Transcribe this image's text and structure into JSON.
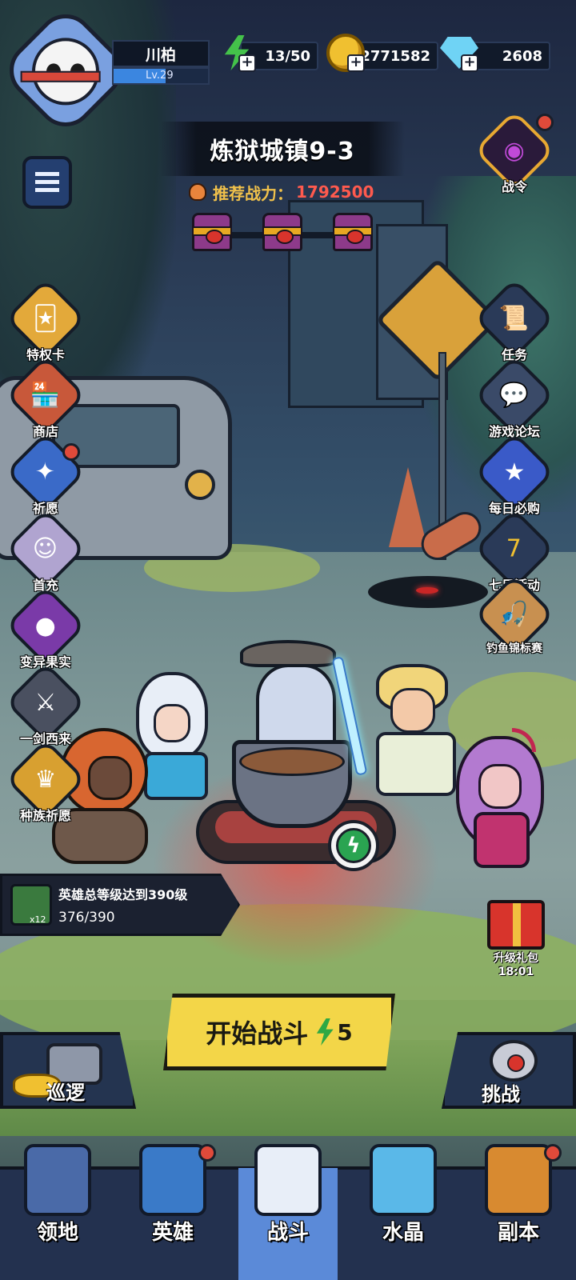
{
  "player": {
    "name": "川柏",
    "level": "Lv.29",
    "level_progress": 0.55
  },
  "resources": {
    "energy": "13/50",
    "gold": "2771582",
    "gems": "2608"
  },
  "stage": {
    "title": "炼狱城镇9-3",
    "power_label": "推荐战力：",
    "power_value": "1792500"
  },
  "left_menu": [
    {
      "label": "特权卡",
      "icon": "privilege-card-icon"
    },
    {
      "label": "商店",
      "icon": "shop-icon"
    },
    {
      "label": "祈愿",
      "icon": "wish-icon"
    },
    {
      "label": "首充",
      "icon": "first-recharge-icon"
    },
    {
      "label": "变异果实",
      "icon": "mutant-fruit-icon"
    },
    {
      "label": "一剑西来",
      "icon": "sword-event-icon"
    },
    {
      "label": "种族祈愿",
      "icon": "race-wish-icon"
    }
  ],
  "right_menu": [
    {
      "label": "战令",
      "icon": "battle-pass-eye-icon"
    },
    {
      "label": "任务",
      "icon": "quest-scroll-icon"
    },
    {
      "label": "游戏论坛",
      "icon": "forum-chat-icon"
    },
    {
      "label": "每日必购",
      "icon": "daily-deal-icon"
    },
    {
      "label": "七日活动",
      "icon": "seven-day-icon"
    },
    {
      "label": "钓鱼锦标赛",
      "icon": "fishing-contest-icon"
    }
  ],
  "quest": {
    "title": "英雄总等级达到390级",
    "progress": "376/390",
    "reward_count": "x12"
  },
  "gift": {
    "label": "升级礼包",
    "timer": "18:01"
  },
  "battle": {
    "start_label": "开始战斗",
    "cost": "5",
    "patrol_label": "巡逻",
    "challenge_label": "挑战"
  },
  "nav": [
    {
      "label": "领地",
      "icon": "territory-castle-icon"
    },
    {
      "label": "英雄",
      "icon": "hero-hat-icon"
    },
    {
      "label": "战斗",
      "icon": "battle-sword-icon",
      "active": true
    },
    {
      "label": "水晶",
      "icon": "crystal-icon"
    },
    {
      "label": "副本",
      "icon": "dungeon-portal-icon"
    }
  ],
  "colors": {
    "accent_yellow": "#f3d648",
    "power_red": "#ff5a4e",
    "nav_active": "#5b8ad8",
    "notification": "#e04a3a"
  }
}
